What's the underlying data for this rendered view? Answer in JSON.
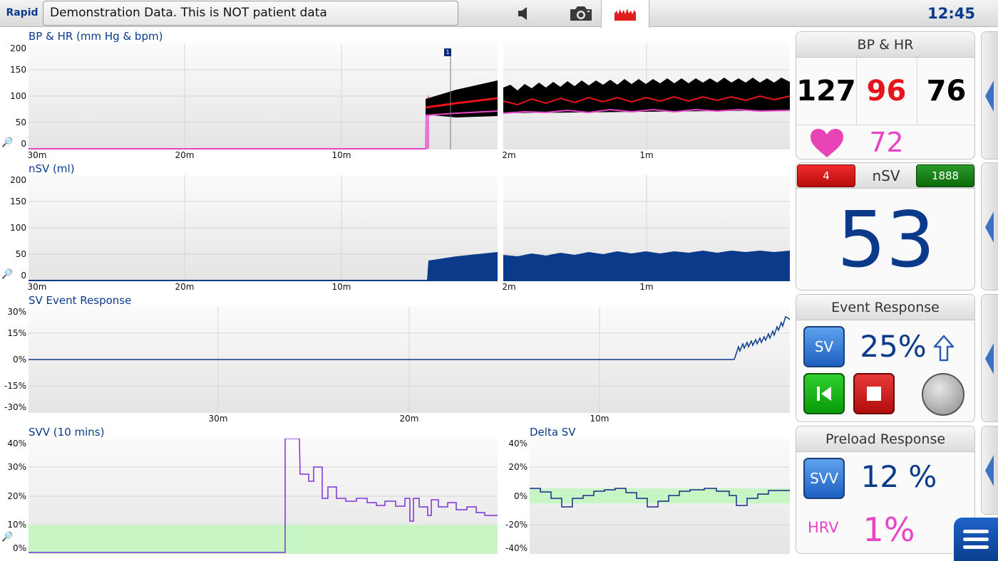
{
  "topbar": {
    "brand": "Rapid",
    "banner": "Demonstration Data. This is NOT patient data",
    "icons": [
      "speaker-icon",
      "camera-icon",
      "trend-icon"
    ],
    "clock": "12:45"
  },
  "charts": {
    "bp_hr": {
      "title": "BP & HR (mm Hg & bpm)",
      "y_ticks": [
        "200",
        "150",
        "100",
        "50",
        "0"
      ],
      "x_ticks_left": [
        "30m",
        "20m",
        "10m"
      ],
      "x_ticks_right": [
        "2m",
        "1m"
      ],
      "event_marker": "1"
    },
    "nsv": {
      "title": "nSV (ml)",
      "y_ticks": [
        "200",
        "150",
        "100",
        "50",
        "0"
      ],
      "x_ticks_left": [
        "30m",
        "20m",
        "10m"
      ],
      "x_ticks_right": [
        "2m",
        "1m"
      ]
    },
    "sv_event": {
      "title": "SV Event Response",
      "y_ticks": [
        "30%",
        "15%",
        "0%",
        "-15%",
        "-30%"
      ],
      "x_ticks": [
        "30m",
        "20m",
        "10m"
      ]
    },
    "svv": {
      "title": "SVV (10 mins)",
      "y_ticks": [
        "40%",
        "30%",
        "20%",
        "10%",
        "0%"
      ]
    },
    "delta_sv": {
      "title": "Delta SV",
      "y_ticks": [
        "40%",
        "20%",
        "0%",
        "-20%",
        "-40%"
      ]
    }
  },
  "panels": {
    "bp_hr": {
      "title": "BP & HR",
      "systolic": "127",
      "mean": "96",
      "diastolic": "76",
      "hr": "72",
      "colors": {
        "systolic": "#000000",
        "mean": "#e8141c",
        "diastolic": "#000000",
        "hr": "#e844c8"
      }
    },
    "nsv": {
      "low_limit": "4",
      "label": "nSV",
      "high_limit": "1888",
      "value": "53"
    },
    "event_response": {
      "title": "Event Response",
      "param_button": "SV",
      "value": "25%",
      "trend_icon": "arrow-up-icon"
    },
    "preload_response": {
      "title": "Preload Response",
      "param_button": "SVV",
      "value": "12 %",
      "hrv_label": "HRV",
      "hrv_value": "1%"
    }
  }
}
